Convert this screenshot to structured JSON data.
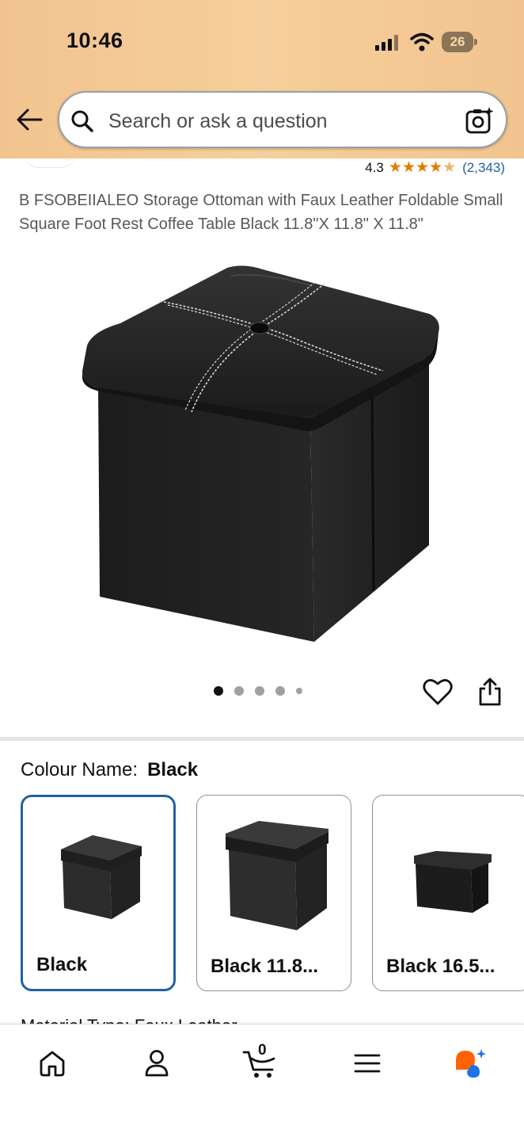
{
  "status_bar": {
    "time": "10:46",
    "battery": "26"
  },
  "search": {
    "placeholder": "Search or ask a question"
  },
  "rating": {
    "value": "4.3",
    "count": "(2,343)",
    "stars": 4.3
  },
  "product": {
    "title": "B FSOBEIIALEO Storage Ottoman with Faux Leather Foldable Small Square Foot Rest Coffee Table Black 11.8\"X 11.8\" X 11.8\"",
    "image_count": 5,
    "active_image": 1
  },
  "colour": {
    "label": "Colour Name:",
    "selected": "Black",
    "options": [
      {
        "label": "Black"
      },
      {
        "label": "Black 11.8..."
      },
      {
        "label": "Black 16.5..."
      }
    ]
  },
  "peek_text": "Material Type: Faux Leather",
  "bottom_nav": {
    "items": [
      "home-icon",
      "account-icon",
      "cart-icon",
      "menu-icon",
      "rufus-icon"
    ],
    "cart_count": "0"
  },
  "colors": {
    "header": "#f5cf9b",
    "link": "#2162a1",
    "star": "#e67a00",
    "selected_border": "#2162a1"
  }
}
